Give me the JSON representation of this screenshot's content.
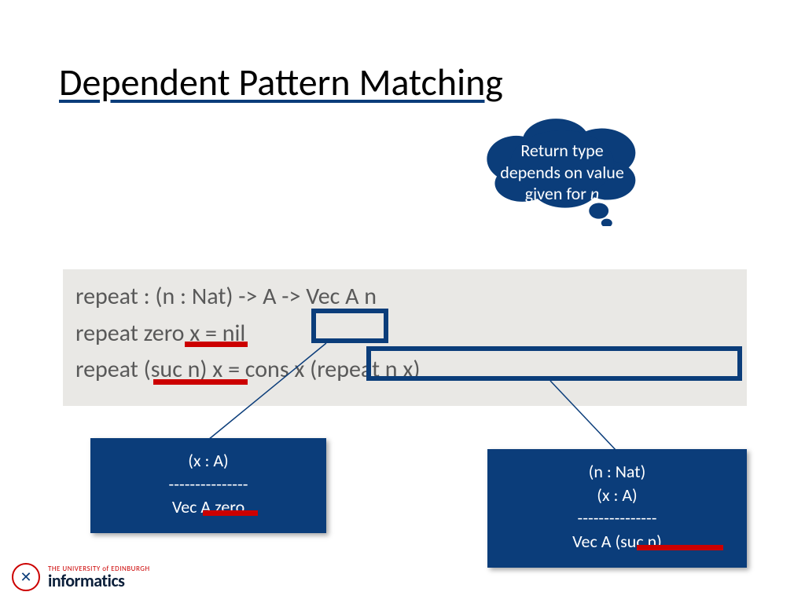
{
  "title": "Dependent Pattern Matching",
  "cloud": {
    "line1": "Return type",
    "line2": "depends on value",
    "line3_prefix": "given for ",
    "line3_var": "n"
  },
  "code": {
    "line1": "repeat : (n : Nat) -> A -> Vec A n",
    "line2": "repeat zero x = nil",
    "line3": "repeat (suc n) x = cons x (repeat n x)"
  },
  "callout_left": {
    "l1": "(x : A)",
    "l2": "---------------",
    "l3": "Vec A zero"
  },
  "callout_right": {
    "l1": "(n : Nat)",
    "l2": "(x : A)",
    "l3": "---------------",
    "l4": "Vec A (suc n)"
  },
  "logo": {
    "university": "THE UNIVERSITY of EDINBURGH",
    "dept": "informatics"
  },
  "colors": {
    "navy": "#0b3d7a",
    "red": "#cc0000",
    "codebg": "#e9e8e5",
    "codefg": "#595959"
  }
}
